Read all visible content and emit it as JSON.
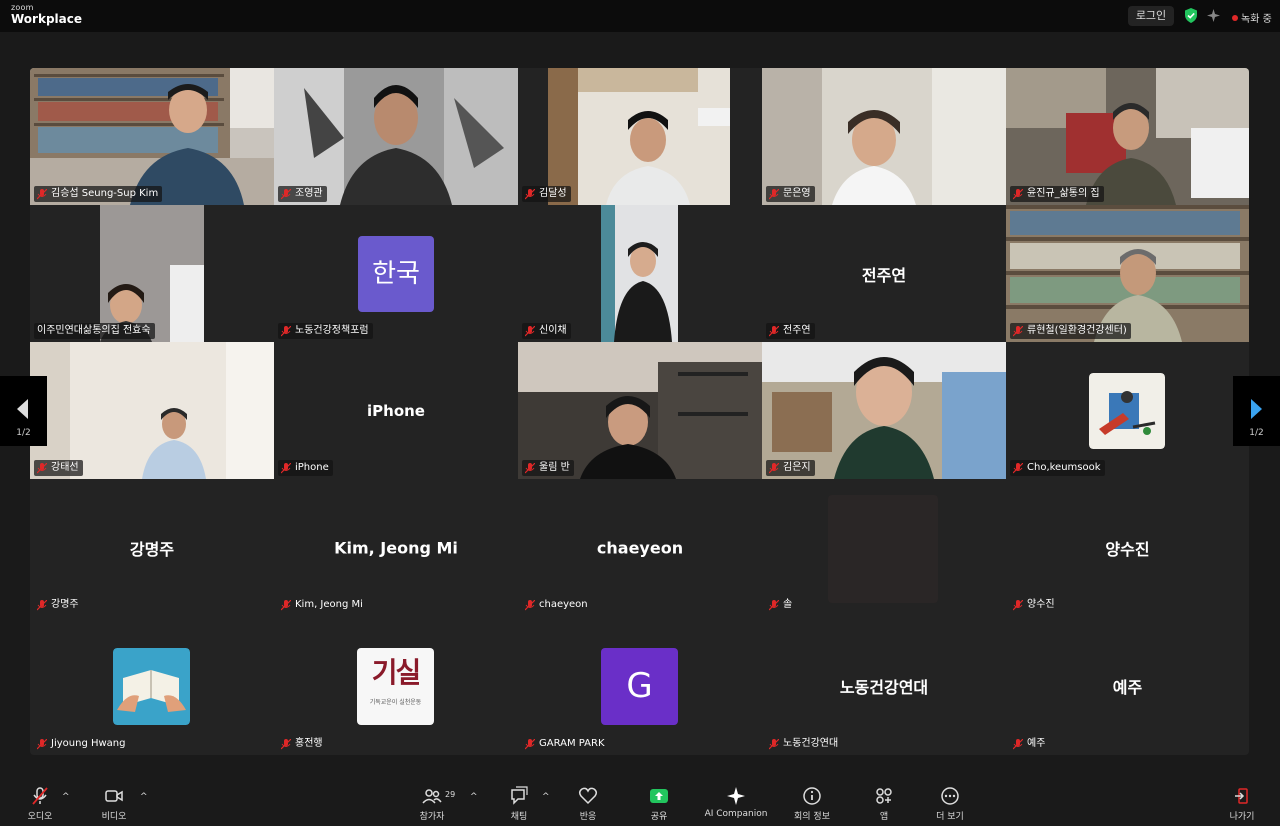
{
  "app": {
    "logo_small": "zoom",
    "logo_big": "Workplace"
  },
  "topbar": {
    "login": "로그인",
    "recording": "녹화 중"
  },
  "pager": {
    "left_page": "1/2",
    "right_page": "1/2"
  },
  "tiles": {
    "t1": {
      "name": "김승섭 Seung-Sup Kim"
    },
    "t2": {
      "name": "조영관"
    },
    "t3": {
      "name": "김달성"
    },
    "t4": {
      "name": "문은영"
    },
    "t5": {
      "name": "윤진규_삶통의 집"
    },
    "t6": {
      "name": "이주민연대삶통의집 전효숙"
    },
    "t7": {
      "name": "노동건강정책포럼",
      "avatar_text": "한국"
    },
    "t8": {
      "name": "신이채"
    },
    "t9": {
      "name": "전주연",
      "display": "전주연"
    },
    "t10": {
      "name": "류현철(일환경건강센터)"
    },
    "t11": {
      "name": "강태선"
    },
    "t12": {
      "name": "iPhone",
      "display": "iPhone"
    },
    "t13": {
      "name": "울림 반"
    },
    "t14": {
      "name": "김은지"
    },
    "t15": {
      "name": "Cho,keumsook"
    },
    "t16": {
      "name": "강명주",
      "display": "강명주"
    },
    "t17": {
      "name": "Kim, Jeong Mi",
      "display": "Kim, Jeong Mi"
    },
    "t18": {
      "name": "chaeyeon",
      "display": "chaeyeon"
    },
    "t19": {
      "name": "솔"
    },
    "t20": {
      "name": "양수진",
      "display": "양수진"
    },
    "t21": {
      "name": "Jiyoung Hwang"
    },
    "t22": {
      "name": "홍전행",
      "avatar_big": "기실",
      "avatar_small": "기독교운이 실천운동"
    },
    "t23": {
      "name": "GARAM PARK",
      "avatar_text": "G"
    },
    "t24": {
      "name": "노동건강연대",
      "display": "노동건강연대"
    },
    "t25": {
      "name": "예주",
      "display": "예주"
    }
  },
  "toolbar": {
    "audio": "오디오",
    "video": "비디오",
    "participants": "참가자",
    "participants_count": "29",
    "chat": "채팅",
    "reactions": "반응",
    "share": "공유",
    "ai": "AI Companion",
    "info": "회의 정보",
    "apps": "앱",
    "more": "더 보기",
    "leave": "나가기"
  },
  "colors": {
    "accent_green": "#23d160",
    "share_green": "#22c55e",
    "avatar_purple": "#6a5acd",
    "muted_red": "#e02828"
  }
}
